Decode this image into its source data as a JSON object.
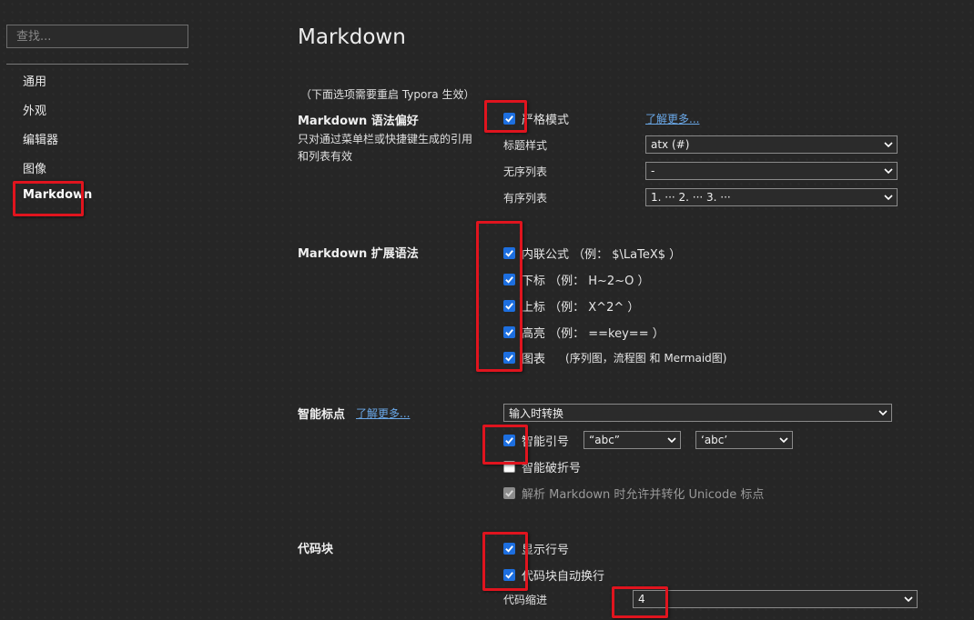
{
  "sidebar": {
    "search_placeholder": "查找...",
    "items": [
      {
        "label": "通用"
      },
      {
        "label": "外观"
      },
      {
        "label": "编辑器"
      },
      {
        "label": "图像"
      },
      {
        "label": "Markdown"
      }
    ]
  },
  "page": {
    "title": "Markdown",
    "restart_note": "（下面选项需要重启 Typora 生效）"
  },
  "syntax_pref": {
    "title": "Markdown 语法偏好",
    "description": "只对通过菜单栏或快捷键生成的引用和列表有效",
    "strict_mode": {
      "label": "严格模式",
      "checked": true
    },
    "learn_more": "了解更多...",
    "heading_style": {
      "label": "标题样式",
      "value": "atx (#)"
    },
    "unordered_list": {
      "label": "无序列表",
      "value": "-"
    },
    "ordered_list": {
      "label": "有序列表",
      "value": "1. ··· 2. ··· 3. ···"
    }
  },
  "extended_syntax": {
    "title": "Markdown 扩展语法",
    "options": [
      {
        "label": "内联公式 （例： $\\LaTeX$ ）",
        "checked": true
      },
      {
        "label": "下标 （例： H~2~O ）",
        "checked": true
      },
      {
        "label": "上标 （例： X^2^ ）",
        "checked": true
      },
      {
        "label": "高亮 （例： ==key== ）",
        "checked": true
      },
      {
        "label": "图表",
        "note": "(序列图，流程图 和 Mermaid图)",
        "checked": true
      }
    ]
  },
  "smart_punct": {
    "title": "智能标点",
    "learn_more": "了解更多...",
    "mode": {
      "value": "输入时转换"
    },
    "smart_quotes": {
      "label": "智能引号",
      "checked": true,
      "double_value": "“abc”",
      "single_value": "‘abc’"
    },
    "smart_dashes": {
      "label": "智能破折号",
      "checked": false
    },
    "unicode_punct": {
      "label": "解析 Markdown 时允许并转化 Unicode 标点",
      "checked": true,
      "disabled": true
    }
  },
  "code_block": {
    "title": "代码块",
    "line_numbers": {
      "label": "显示行号",
      "checked": true
    },
    "word_wrap": {
      "label": "代码块自动换行",
      "checked": true
    },
    "indent": {
      "label": "代码缩进",
      "value": "4"
    }
  },
  "colors": {
    "accent": "#1d6fe0",
    "link": "#6aa8e8",
    "highlight": "#e0141e",
    "background": "#262626"
  }
}
